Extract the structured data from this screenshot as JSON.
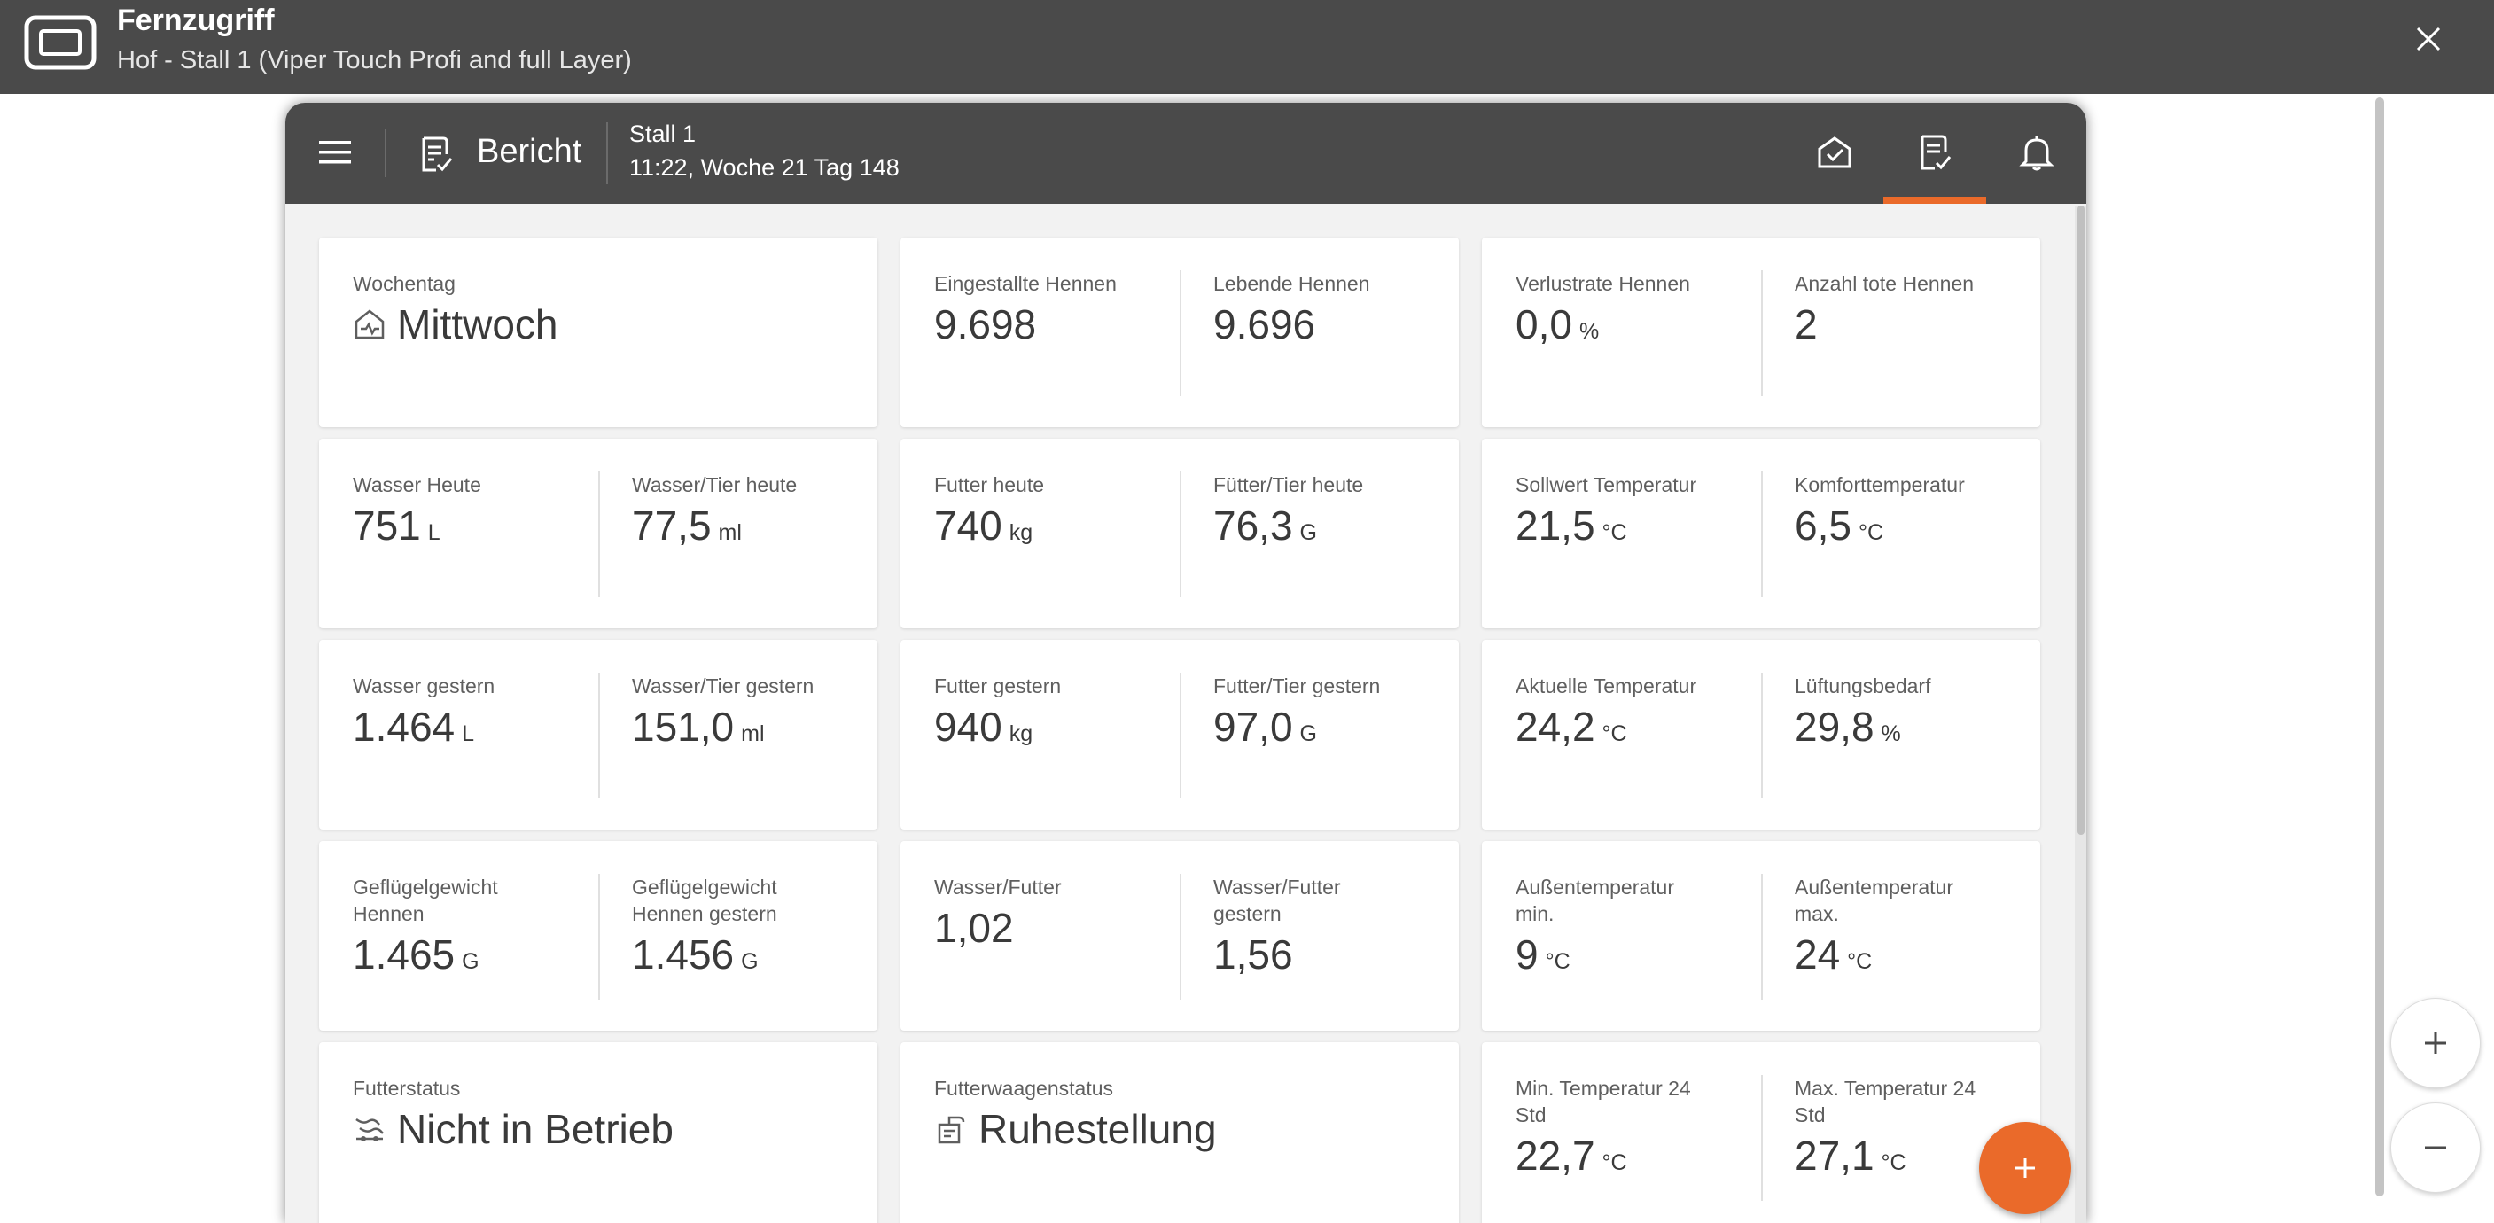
{
  "window": {
    "title": "Fernzugriff",
    "subtitle": "Hof - Stall 1 (Viper Touch Profi and full Layer)",
    "app_icon": "remote-screen-icon",
    "close_icon": "close-icon"
  },
  "header": {
    "menu_icon": "hamburger-menu-icon",
    "report_icon": "report-icon",
    "title": "Bericht",
    "stall": "Stall 1",
    "time": "11:22, Woche 21 Tag 148",
    "nav": [
      {
        "icon": "overview-icon",
        "active": false
      },
      {
        "icon": "report-icon",
        "active": true
      },
      {
        "icon": "bell-icon",
        "active": false
      }
    ],
    "accent_color": "#ea6a2a"
  },
  "cards": {
    "weekday": {
      "label": "Wochentag",
      "value": "Mittwoch",
      "icon": "house-icon"
    },
    "hens_housed": {
      "label": "Eingestallte Hennen",
      "value": "9.698"
    },
    "hens_alive": {
      "label": "Lebende Hennen",
      "value": "9.696"
    },
    "loss_rate": {
      "label": "Verlustrate Hennen",
      "value": "0,0",
      "unit": "%"
    },
    "dead_hens": {
      "label": "Anzahl tote Hennen",
      "value": "2"
    },
    "water_today": {
      "label": "Wasser Heute",
      "value": "751",
      "unit": "L"
    },
    "water_per_animal_today": {
      "label": "Wasser/Tier heute",
      "value": "77,5",
      "unit": "ml"
    },
    "feed_today": {
      "label": "Futter heute",
      "value": "740",
      "unit": "kg"
    },
    "feed_per_animal_today": {
      "label": "Fütter/Tier heute",
      "value": "76,3",
      "unit": "G"
    },
    "setpoint_temp": {
      "label": "Sollwert Temperatur",
      "value": "21,5",
      "unit": "°C"
    },
    "comfort_temp": {
      "label": "Komforttemperatur",
      "value": "6,5",
      "unit": "°C"
    },
    "water_yesterday": {
      "label": "Wasser gestern",
      "value": "1.464",
      "unit": "L"
    },
    "water_per_animal_yesterday": {
      "label": "Wasser/Tier gestern",
      "value": "151,0",
      "unit": "ml"
    },
    "feed_yesterday": {
      "label": "Futter gestern",
      "value": "940",
      "unit": "kg"
    },
    "feed_per_animal_yesterday": {
      "label": "Futter/Tier gestern",
      "value": "97,0",
      "unit": "G"
    },
    "current_temp": {
      "label": "Aktuelle Temperatur",
      "value": "24,2",
      "unit": "°C"
    },
    "ventilation_demand": {
      "label": "Lüftungsbedarf",
      "value": "29,8",
      "unit": "%"
    },
    "poultry_weight": {
      "label": "Geflügelgewicht Hennen",
      "value": "1.465",
      "unit": "G"
    },
    "poultry_weight_yesterday": {
      "label": "Geflügelgewicht Hennen gestern",
      "value": "1.456",
      "unit": "G"
    },
    "water_feed": {
      "label": "Wasser/Futter",
      "value": "1,02"
    },
    "water_feed_yesterday": {
      "label": "Wasser/Futter gestern",
      "value": "1,56"
    },
    "outside_temp_min": {
      "label": "Außentemperatur min.",
      "value": "9",
      "unit": "°C"
    },
    "outside_temp_max": {
      "label": "Außentemperatur max.",
      "value": "24",
      "unit": "°C"
    },
    "feed_status": {
      "label": "Futterstatus",
      "value": "Nicht in Betrieb",
      "icon": "feed-chain-icon"
    },
    "feed_scale_status": {
      "label": "Futterwaagenstatus",
      "value": "Ruhestellung",
      "icon": "feed-scale-icon"
    },
    "min_temp_24h": {
      "label": "Min. Temperatur 24 Std",
      "value": "22,7",
      "unit": "°C"
    },
    "max_temp_24h": {
      "label": "Max. Temperatur 24 Std",
      "value": "27,1",
      "unit": "°C"
    }
  },
  "controls": {
    "fab_icon": "plus-icon",
    "zoom_in_icon": "zoom-in-icon",
    "zoom_out_icon": "zoom-out-icon"
  }
}
